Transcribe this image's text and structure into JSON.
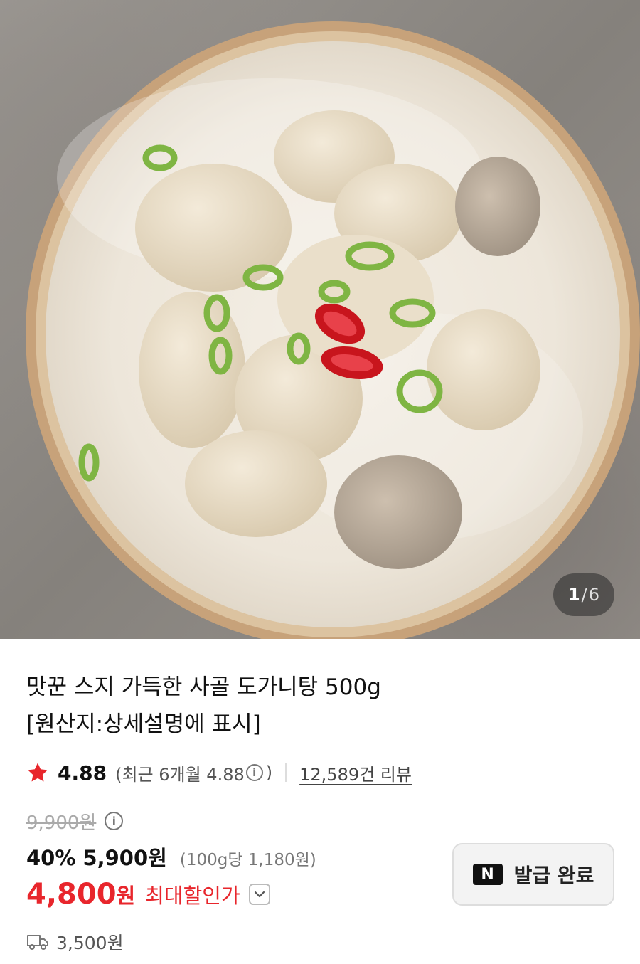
{
  "image_counter": {
    "current": "1",
    "separator": "/",
    "total": "6"
  },
  "product": {
    "title_line1": "맛꾼 스지 가득한 사골 도가니탕 500g",
    "title_line2": "[원산지:상세설명에 표시]"
  },
  "rating": {
    "score": "4.88",
    "recent_prefix": "(최근 6개월 4.88",
    "info_glyph": "i",
    "recent_suffix": ")",
    "review_link": "12,589건 리뷰"
  },
  "price": {
    "original": "9,900원",
    "info_glyph": "i",
    "discount": "40%",
    "sale": "5,900원",
    "unit_price": "(100g당 1,180원)",
    "max_price_number": "4,800",
    "max_price_unit": "원",
    "max_label": "최대할인가"
  },
  "coupon": {
    "badge": "N",
    "label": "발급 완료"
  },
  "shipping": {
    "fee": "3,500원"
  },
  "colors": {
    "accent_red": "#e8262c",
    "star": "#e8262c"
  },
  "icons": [
    "star-icon",
    "info-icon",
    "chevron-down-icon",
    "naver-n-icon",
    "truck-icon"
  ]
}
